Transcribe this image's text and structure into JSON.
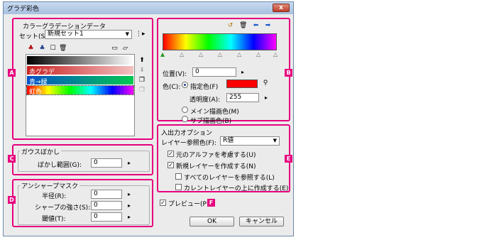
{
  "window": {
    "title": "グラデ彩色",
    "close_label": "x"
  },
  "sections": {
    "A": {
      "badge": "A",
      "title": "カラーグラデーションデータ",
      "set_label": "セット(S):",
      "set_value": "新規セット1",
      "items": [
        {
          "label": "",
          "colors": [
            "#000000",
            "#ffffff"
          ]
        },
        {
          "label": "赤グラデ",
          "colors": [
            "#c81e1e",
            "#f3c2c2"
          ]
        },
        {
          "label": "青→緑",
          "colors": [
            "#0050c8",
            "#00c850"
          ]
        },
        {
          "label": "虹色",
          "colors": [
            "#ff0000",
            "#ffff00",
            "#00ff00",
            "#00ffff",
            "#0000ff",
            "#ff00ff"
          ]
        }
      ]
    },
    "B": {
      "badge": "B",
      "position_label": "位置(V):",
      "position_value": "0",
      "color_label": "色(C):",
      "specified_color_label": "指定色(F)",
      "specified_color": "#ff0000",
      "opacity_label": "透明度(A):",
      "opacity_value": "255",
      "main_color_label": "メイン描画色(M)",
      "sub_color_label": "サブ描画色(B)",
      "gradient_colors": [
        "#ff0000",
        "#ffff00",
        "#00ff00",
        "#00ffff",
        "#0000ff",
        "#ff00ff"
      ]
    },
    "C": {
      "badge": "C",
      "title": "ガウスぼかし",
      "blur_label": "ぼかし範囲(G):",
      "blur_value": "0"
    },
    "D": {
      "badge": "D",
      "title": "アンシャープマスク",
      "radius_label": "半径(R):",
      "radius_value": "0",
      "sharpness_label": "シャープの強さ(S):",
      "sharpness_value": "0",
      "threshold_label": "閾値(T):",
      "threshold_value": "0"
    },
    "E": {
      "badge": "E",
      "title": "入出力オプション",
      "ref_color_label": "レイヤー参照色(F):",
      "ref_color_value": "R値",
      "opt_alpha": "元のアルファを考慮する(U)",
      "opt_new_layer": "新規レイヤーを作成する(N)",
      "opt_ref_all": "すべてのレイヤーを参照する(L)",
      "opt_above_current": "カレントレイヤーの上に作成する(E)"
    },
    "F": {
      "badge": "F",
      "preview_label": "プレビュー(P)"
    }
  },
  "buttons": {
    "ok": "OK",
    "cancel": "キャンセル"
  }
}
